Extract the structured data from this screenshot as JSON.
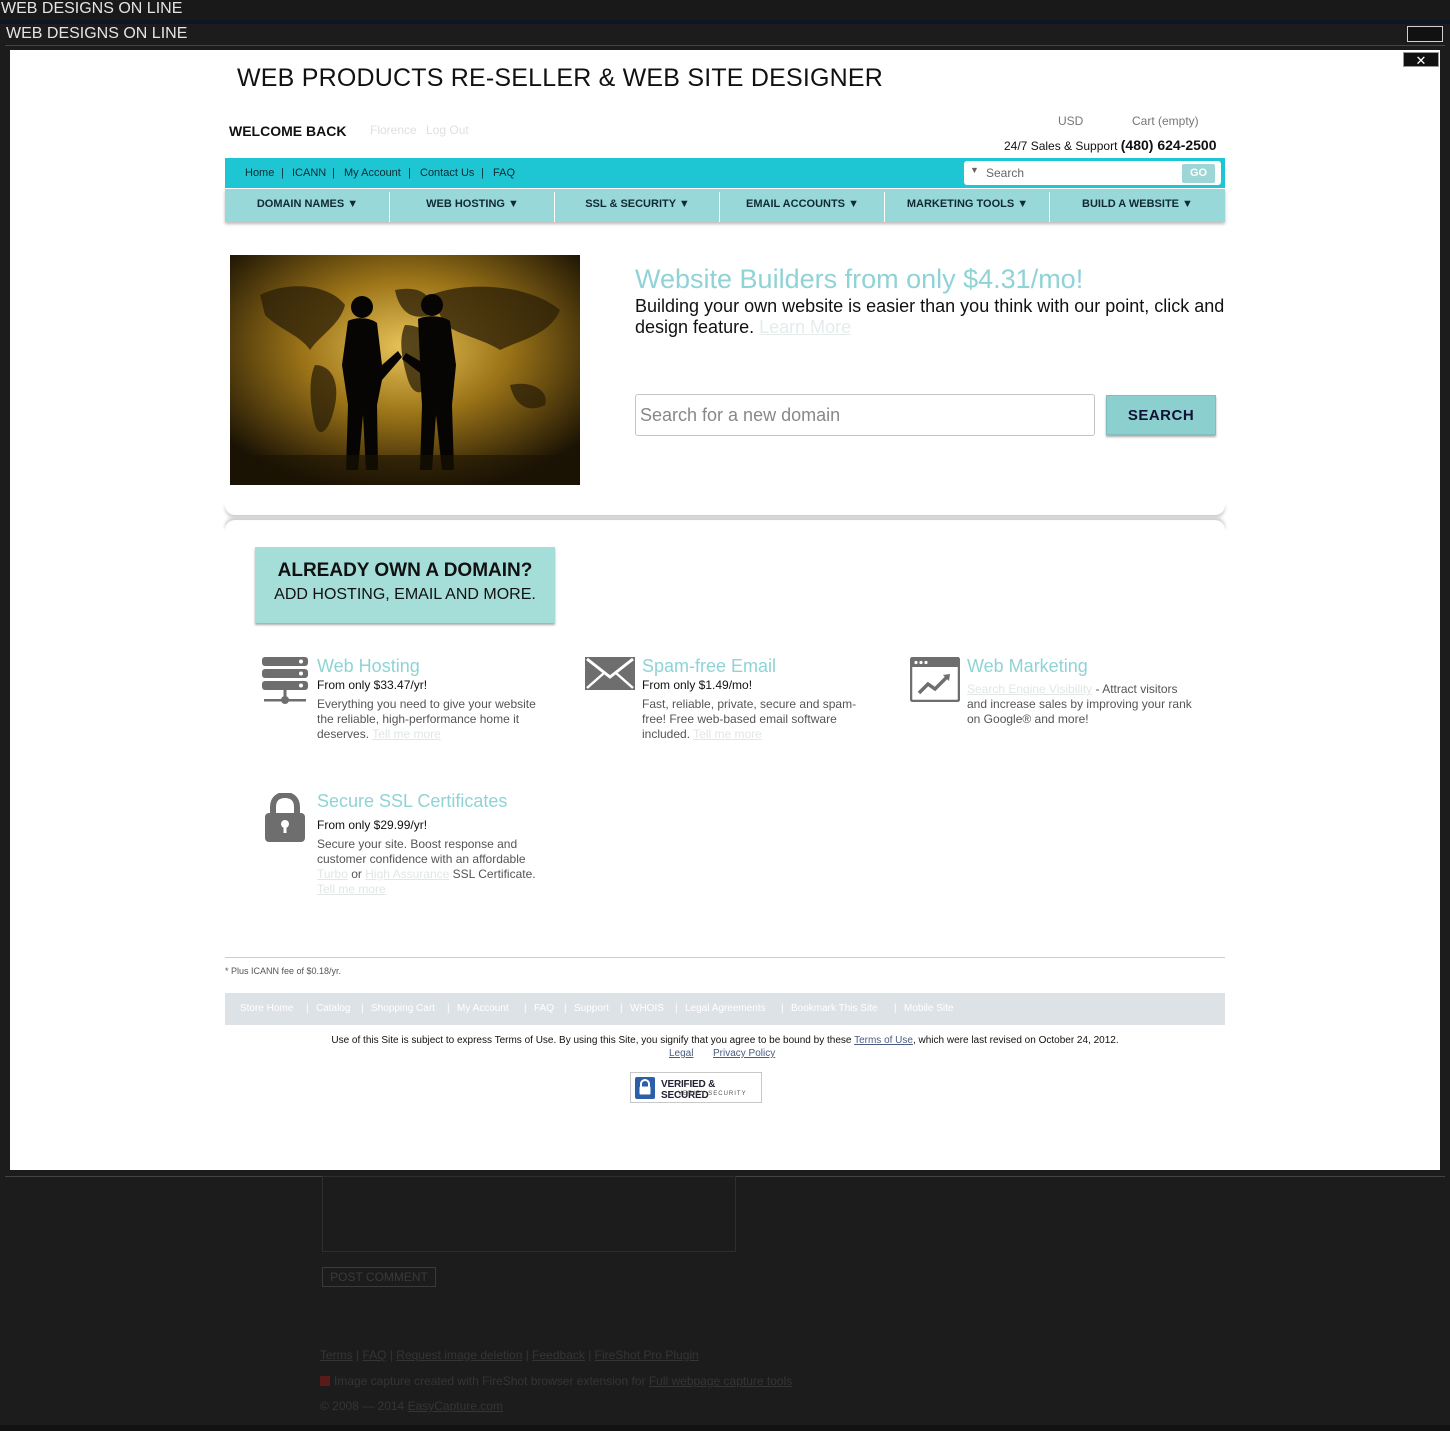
{
  "window": {
    "title": "WEB DESIGNS ON LINE",
    "lightbox_title": "WEB DESIGNS ON LINE",
    "close_glyph": "✕"
  },
  "header": {
    "site_title": "WEB PRODUCTS RE-SELLER & WEB SITE DESIGNER",
    "welcome": "WELCOME BACK",
    "user_name": "Florence",
    "logout": "Log Out",
    "currency": "USD",
    "cart": "Cart (empty)",
    "support_label": "24/7 Sales & Support",
    "support_phone": "(480) 624-2500"
  },
  "util_nav": {
    "links": [
      "Home",
      "ICANN",
      "My Account",
      "Contact Us",
      "FAQ"
    ],
    "separator": "|",
    "search_placeholder": "Search",
    "search_arrow": "▼",
    "go": "GO"
  },
  "main_nav": [
    "DOMAIN NAMES ▼",
    "WEB HOSTING ▼",
    "SSL & SECURITY ▼",
    "EMAIL ACCOUNTS ▼",
    "MARKETING TOOLS ▼",
    "BUILD A WEBSITE ▼"
  ],
  "hero": {
    "title": "Website Builders from only $4.31/mo!",
    "body": "Building your own website is easier than you think with our point, click and design feature.",
    "learn_more": "Learn More",
    "domain_placeholder": "Search for a new domain",
    "search_button": "SEARCH"
  },
  "own_domain": {
    "heading": "ALREADY OWN A DOMAIN?",
    "sub": "ADD HOSTING, EMAIL AND MORE."
  },
  "features": {
    "hosting": {
      "title": "Web Hosting",
      "price": "From only $33.47/yr!",
      "desc": "Everything you need to give your website the reliable, high-performance home it deserves.",
      "link": "Tell me more",
      "icon": "server-icon"
    },
    "email": {
      "title": "Spam-free Email",
      "price": "From only $1.49/mo!",
      "desc": "Fast, reliable, private, secure and spam-free! Free web-based email software included.",
      "link": "Tell me more",
      "icon": "envelope-icon"
    },
    "marketing": {
      "title": "Web Marketing",
      "link": "Search Engine Visibility",
      "desc": "- Attract visitors and increase sales by improving your rank on Google® and more!",
      "icon": "chart-window-icon"
    },
    "ssl": {
      "title": "Secure SSL Certificates",
      "price": "From only $29.99/yr!",
      "desc": "Secure your site. Boost response and customer confidence with an affordable",
      "turbo": "Turbo",
      "or": "or",
      "high": "High Assurance",
      "cert": "SSL Certificate.",
      "link": "Tell me more",
      "icon": "padlock-icon"
    }
  },
  "footer": {
    "icann_note": "* Plus ICANN fee of $0.18/yr.",
    "links": [
      "Store Home",
      "Catalog",
      "Shopping Cart",
      "My Account",
      "FAQ",
      "Support",
      "WHOIS",
      "Legal Agreements",
      "Bookmark This Site",
      "Mobile Site"
    ],
    "separator": "|",
    "terms_before": "Use of this Site is subject to express Terms of Use. By using this Site, you signify that you agree to be bound by these",
    "terms_link": "Terms of Use",
    "terms_after": ", which were last revised on October 24, 2012.",
    "legal": "Legal",
    "privacy": "Privacy Policy",
    "seal_line1": "VERIFIED & SECURED",
    "seal_line2": "VERIFY SECURITY"
  },
  "background_page": {
    "post_comment": "POST COMMENT",
    "links": [
      "Terms",
      "FAQ",
      "Request image deletion",
      "Feedback",
      "FireShot Pro Plugin"
    ],
    "note_text": "Image capture created with FireShot browser extension for",
    "note_link": "Full webpage capture tools",
    "copyright_text": "© 2008 — 2014",
    "copyright_link": "EasyCapture.com"
  },
  "colors": {
    "accent_teal": "#1ec5d2",
    "nav_teal": "#99d8d8",
    "title_teal": "#8fd3d6",
    "box_teal": "#a5ded9"
  }
}
